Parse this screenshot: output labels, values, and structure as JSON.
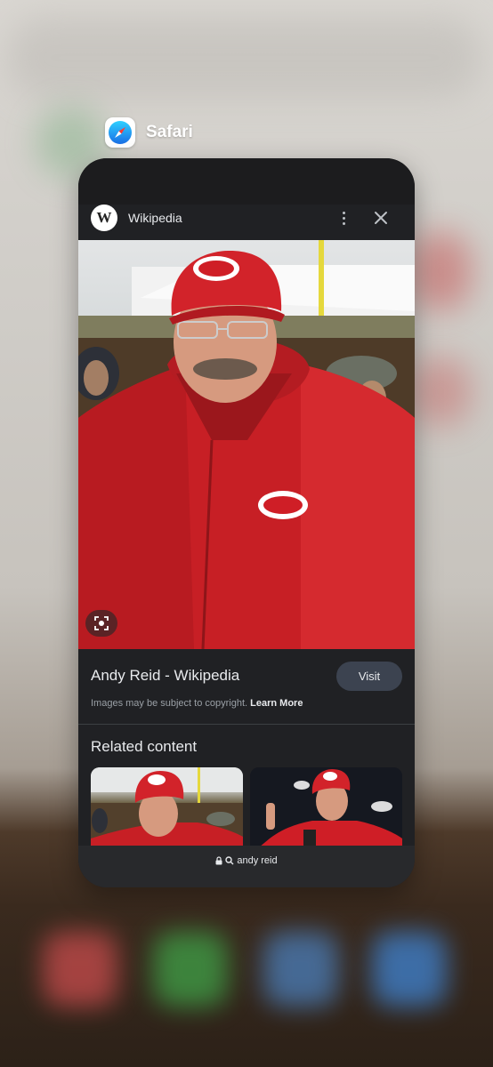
{
  "app_switcher": {
    "app_name": "Safari",
    "app_icon": "compass-icon"
  },
  "card": {
    "site_logo_letter": "W",
    "site_name": "Wikipedia",
    "menu_icon": "more-vert-icon",
    "close_icon": "close-icon",
    "image_alt": "Andy Reid in red Kansas City Chiefs jacket and cap",
    "lens_icon": "lens-icon",
    "page_title": "Andy Reid - Wikipedia",
    "visit_label": "Visit",
    "copyright_text": "Images may be subject to copyright.",
    "learn_more_label": "Learn More",
    "related_heading": "Related content",
    "search_query": "andy reid",
    "lock_icon": "lock-icon",
    "search_icon": "search-icon"
  },
  "colors": {
    "card_bg": "#202124",
    "chiefs_red": "#cf1e26",
    "visit_bg": "#3c4350"
  }
}
